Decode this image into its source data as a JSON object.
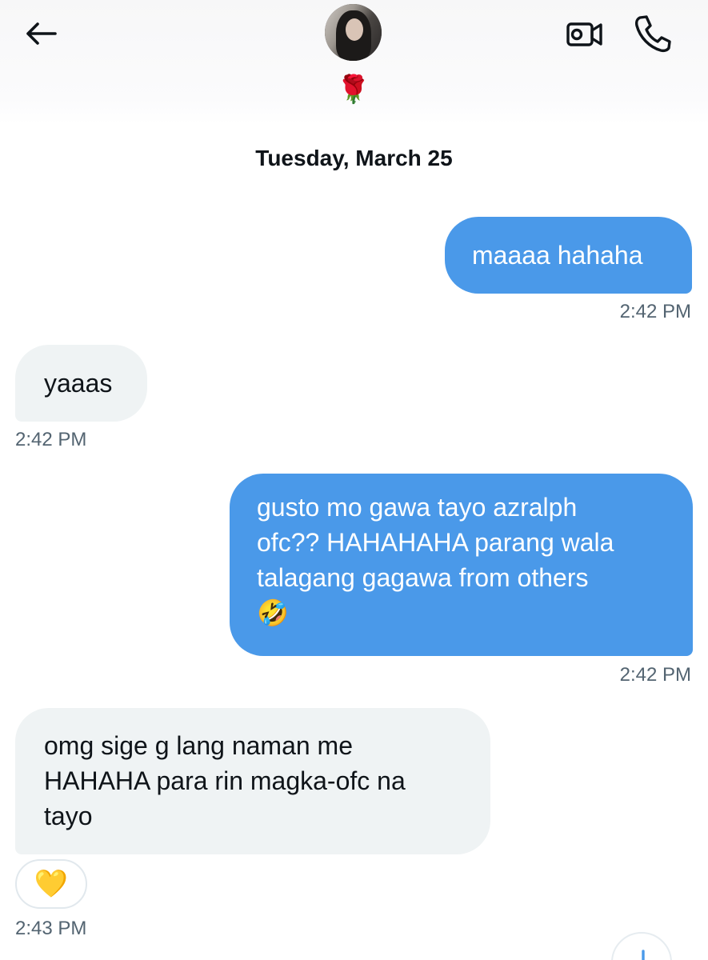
{
  "header": {
    "contact_badge_emoji": "🌹",
    "icons": [
      "back-arrow-icon",
      "video-camera-icon",
      "phone-icon"
    ]
  },
  "date_separator": "Tuesday, March 25",
  "messages": [
    {
      "direction": "outgoing",
      "text": "maaaa hahaha",
      "time": "2:42 PM"
    },
    {
      "direction": "incoming",
      "text": "yaaas",
      "time": "2:42 PM"
    },
    {
      "direction": "outgoing",
      "lines": [
        "gusto mo gawa tayo azralph",
        "ofc?? HAHAHAHA parang wala",
        "talagang gagawa from others",
        "🤣"
      ],
      "time": "2:42 PM"
    },
    {
      "direction": "incoming",
      "lines": [
        "omg sige g lang naman me",
        "HAHAHA para rin magka-ofc na",
        "tayo"
      ],
      "reaction": "💛",
      "time": "2:43 PM"
    }
  ],
  "colors": {
    "outgoing_bubble": "#4a99e9",
    "incoming_bubble": "#eff3f4",
    "timestamp": "#536471",
    "text": "#0f1419"
  }
}
